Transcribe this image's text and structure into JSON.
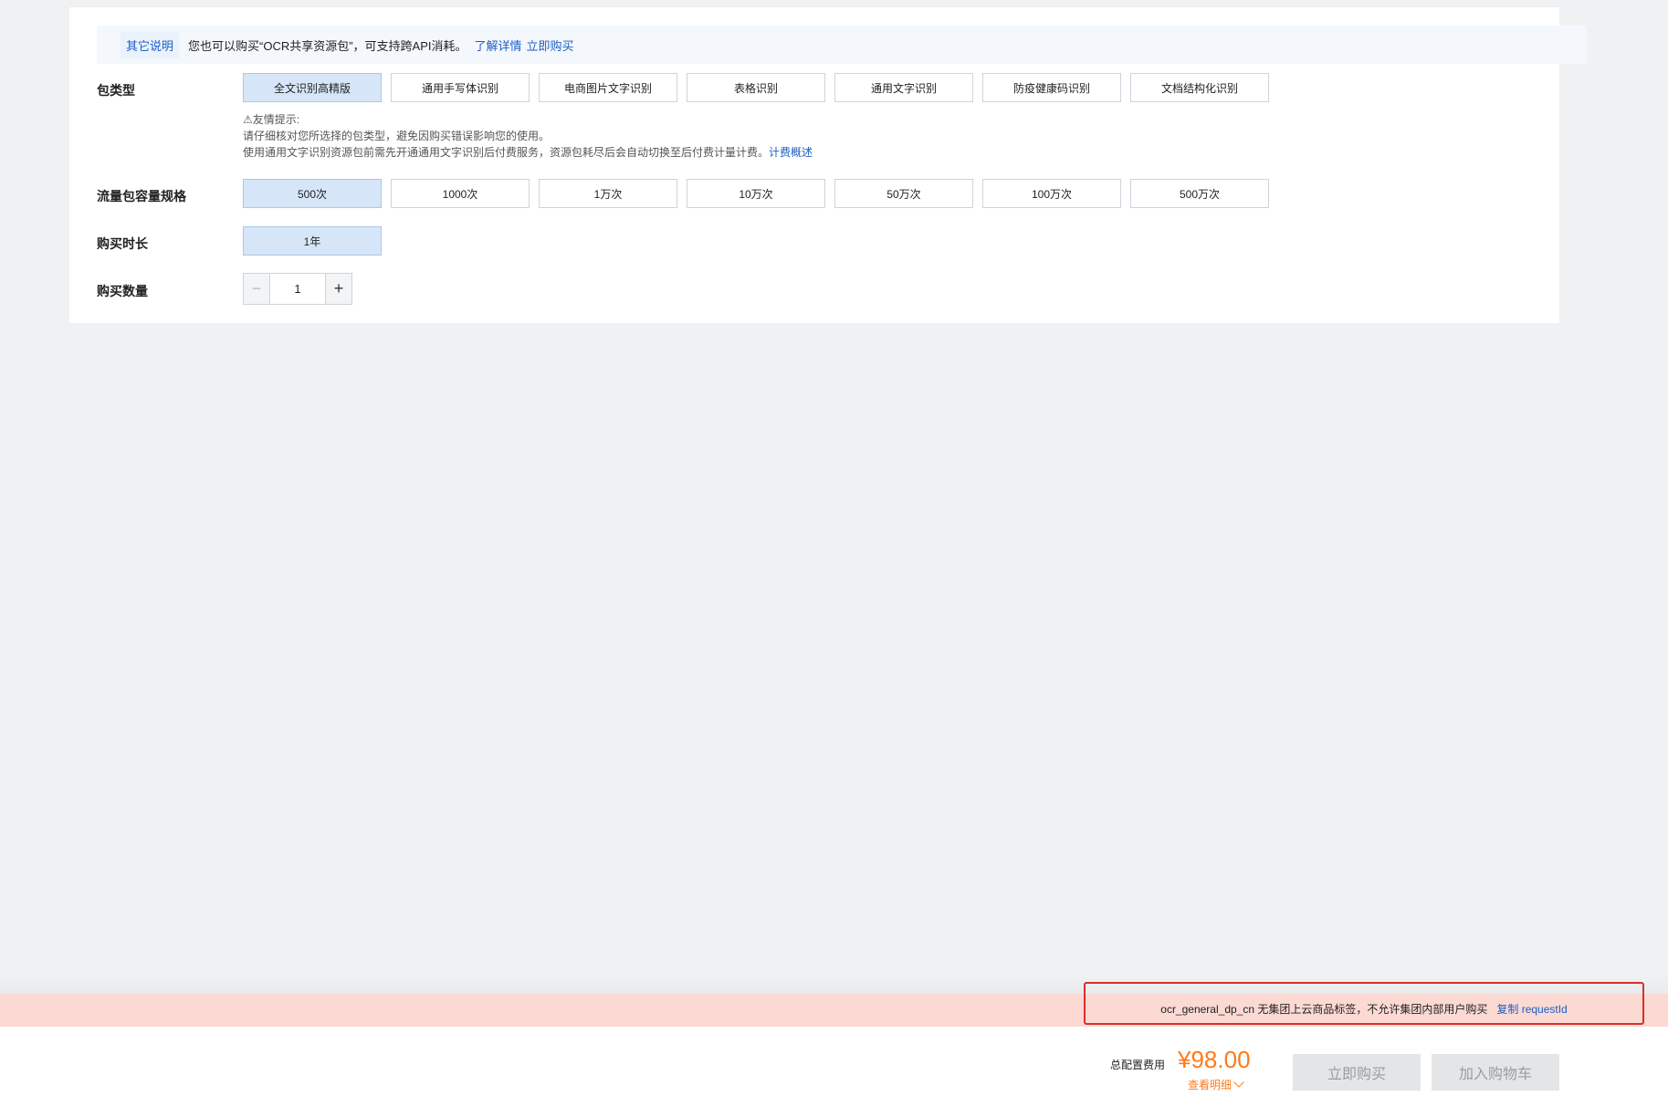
{
  "notice": {
    "tag": "其它说明",
    "message": "您也可以购买“OCR共享资源包”，可支持跨API消耗。",
    "links": [
      "了解详情",
      "立即购买"
    ]
  },
  "package_type": {
    "label": "包类型",
    "options": [
      "全文识别高精版",
      "通用手写体识别",
      "电商图片文字识别",
      "表格识别",
      "通用文字识别",
      "防疫健康码识别",
      "文档结构化识别"
    ],
    "selected_index": 0
  },
  "tips": {
    "title": "⚠友情提示:",
    "line1": "请仔细核对您所选择的包类型，避免因购买错误影响您的使用。",
    "line2": "使用通用文字识别资源包前需先开通通用文字识别后付费服务，资源包耗尽后会自动切换至后付费计量计费。",
    "link": "计费概述"
  },
  "capacity": {
    "label": "流量包容量规格",
    "options": [
      "500次",
      "1000次",
      "1万次",
      "10万次",
      "50万次",
      "100万次",
      "500万次"
    ],
    "selected_index": 0
  },
  "duration": {
    "label": "购买时长",
    "options": [
      "1年"
    ],
    "selected_index": 0
  },
  "quantity": {
    "label": "购买数量",
    "value": "1",
    "minus": "−",
    "plus": "+"
  },
  "error": {
    "message": "ocr_general_dp_cn 无集团上云商品标签，不允许集团内部用户购买",
    "link": "复制 requestId"
  },
  "footer": {
    "total_label": "总配置费用",
    "price": "¥98.00",
    "detail_link": "查看明细",
    "buy_now": "立即购买",
    "add_to_cart": "加入购物车"
  },
  "colors": {
    "accent": "#1a5fc4",
    "price": "#ff7a17",
    "selected_bg": "#d6e6f8",
    "error_bar": "#fcd9d3",
    "error_border": "#d9302b"
  }
}
